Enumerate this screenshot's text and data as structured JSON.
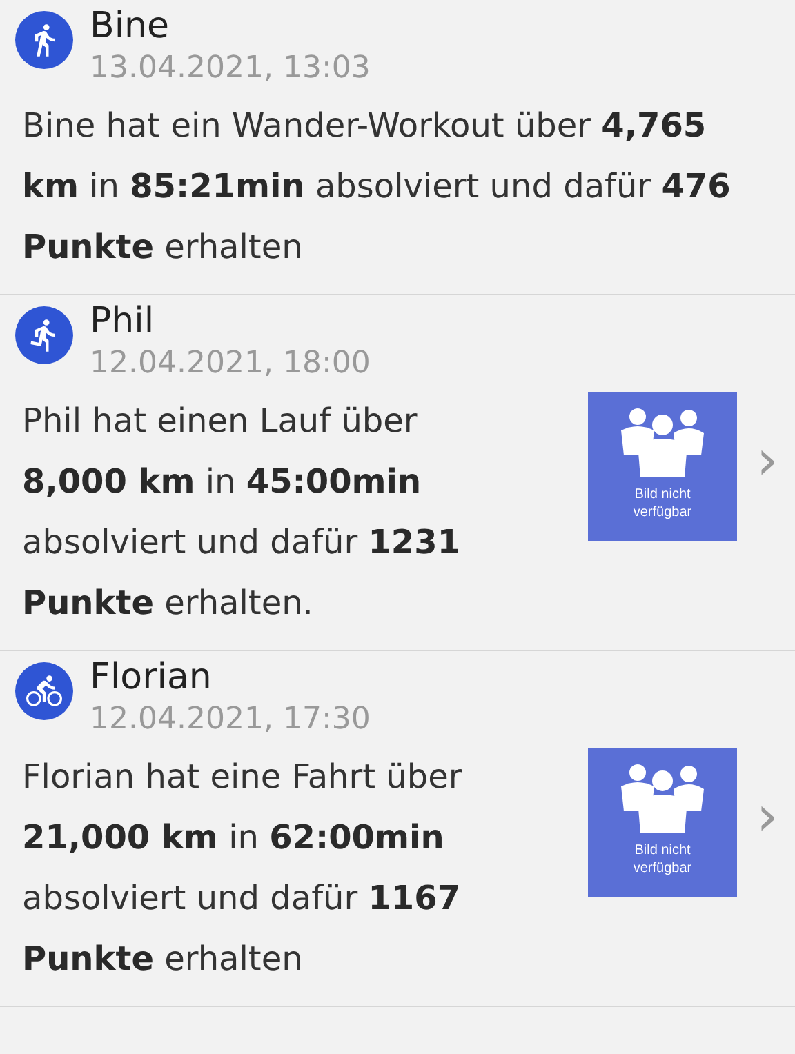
{
  "feed": [
    {
      "kind": "walk",
      "name": "Bine",
      "date": "13.04.2021, 13:03",
      "text": "Bine hat ein Wander-Workout über **4,765 km** in **85:21min** absolviert und dafür **476 Punkte** erhalten"
    },
    {
      "kind": "run",
      "name": "Phil",
      "date": "12.04.2021, 18:00",
      "text": "Phil hat einen Lauf über **8,000 km** in **45:00min** absolviert und dafür **1231 Punkte** erhalten.",
      "image_placeholder": "Bild nicht verfügbar",
      "chevron": "›"
    },
    {
      "kind": "bike",
      "name": "Florian",
      "date": "12.04.2021, 17:30",
      "text": "Florian hat eine Fahrt über **21,000 km** in **62:00min** absolviert und dafür **1167 Punkte** erhalten",
      "image_placeholder": "Bild nicht verfügbar",
      "chevron": "›"
    }
  ]
}
